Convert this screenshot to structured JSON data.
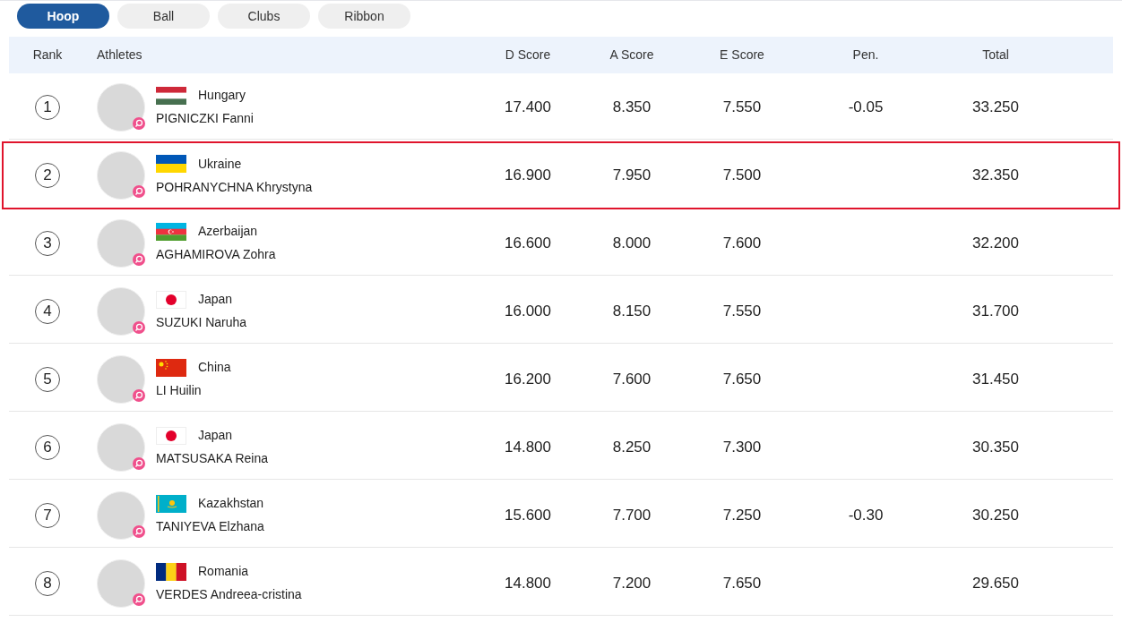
{
  "tabs": [
    {
      "label": "Hoop",
      "selected": true
    },
    {
      "label": "Ball",
      "selected": false
    },
    {
      "label": "Clubs",
      "selected": false
    },
    {
      "label": "Ribbon",
      "selected": false
    }
  ],
  "table": {
    "columns": [
      "Rank",
      "Athletes",
      "D Score",
      "A Score",
      "E Score",
      "Pen.",
      "Total"
    ],
    "rows": [
      {
        "rank": "1",
        "flag": {
          "kind": "hungary"
        },
        "country": "Hungary",
        "name": "PIGNICZKI Fanni",
        "d_score": "17.400",
        "a_score": "8.350",
        "e_score": "7.550",
        "pen": "-0.05",
        "total": "33.250",
        "highlighted": false
      },
      {
        "rank": "2",
        "flag": {
          "kind": "ukraine"
        },
        "country": "Ukraine",
        "name": "POHRANYCHNA Khrystyna",
        "d_score": "16.900",
        "a_score": "7.950",
        "e_score": "7.500",
        "total": "32.350",
        "highlighted": true
      },
      {
        "rank": "3",
        "flag": {
          "kind": "azerbaijan"
        },
        "country": "Azerbaijan",
        "name": "AGHAMIROVA Zohra",
        "d_score": "16.600",
        "a_score": "8.000",
        "e_score": "7.600",
        "total": "32.200",
        "highlighted": false
      },
      {
        "rank": "4",
        "flag": {
          "kind": "japan"
        },
        "country": "Japan",
        "name": "SUZUKI Naruha",
        "d_score": "16.000",
        "a_score": "8.150",
        "e_score": "7.550",
        "total": "31.700",
        "highlighted": false
      },
      {
        "rank": "5",
        "flag": {
          "kind": "china"
        },
        "country": "China",
        "name": "LI Huilin",
        "d_score": "16.200",
        "a_score": "7.600",
        "e_score": "7.650",
        "total": "31.450",
        "highlighted": false
      },
      {
        "rank": "6",
        "flag": {
          "kind": "japan"
        },
        "country": "Japan",
        "name": "MATSUSAKA Reina",
        "d_score": "14.800",
        "a_score": "8.250",
        "e_score": "7.300",
        "total": "30.350",
        "highlighted": false
      },
      {
        "rank": "7",
        "flag": {
          "kind": "kazakhstan"
        },
        "country": "Kazakhstan",
        "name": "TANIYEVA Elzhana",
        "d_score": "15.600",
        "a_score": "7.700",
        "e_score": "7.250",
        "pen": "-0.30",
        "total": "30.250",
        "highlighted": false
      },
      {
        "rank": "8",
        "flag": {
          "kind": "romania"
        },
        "country": "Romania",
        "name": "VERDES Andreea-cristina",
        "d_score": "14.800",
        "a_score": "7.200",
        "e_score": "7.650",
        "total": "29.650",
        "highlighted": false
      }
    ]
  }
}
